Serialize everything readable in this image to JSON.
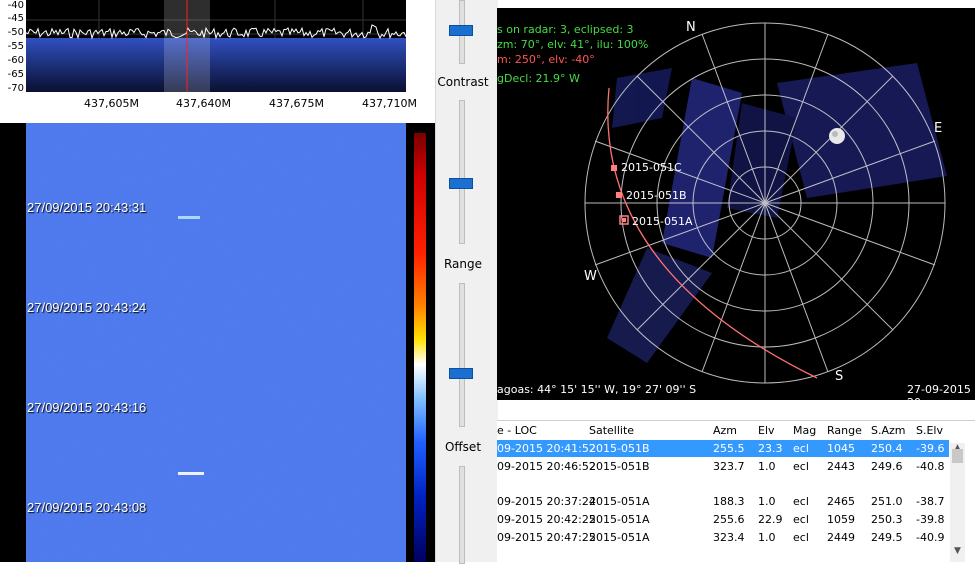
{
  "spectrum": {
    "y_labels": [
      "-40",
      "-45",
      "-50",
      "-55",
      "-60",
      "-65",
      "-70"
    ],
    "x_labels": [
      "437,605M",
      "437,640M",
      "437,675M",
      "437,710M"
    ]
  },
  "waterfall": {
    "timestamps": [
      "27/09/2015 20:43:31",
      "27/09/2015 20:43:24",
      "27/09/2015 20:43:16",
      "27/09/2015 20:43:08"
    ]
  },
  "controls": {
    "contrast_label": "Contrast",
    "range_label": "Range",
    "offset_label": "Offset"
  },
  "radar": {
    "info_line1": "s on radar: 3, eclipsed: 3",
    "info_line2": "zm: 70°, elv: 41°, ilu: 100%",
    "info_line3": "m: 250°, elv: -40°",
    "info_line4": "gDecl: 21.9° W",
    "compass_n": "N",
    "compass_e": "E",
    "compass_s": "S",
    "compass_w": "W",
    "sat1": "2015-051C",
    "sat2": "2015-051B",
    "sat3": "2015-051A",
    "location": "agoas: 44° 15' 15'' W, 19° 27' 09'' S",
    "datetime": "27-09-2015 20",
    "color_info1": "#44dd44",
    "color_info3": "#ff5555"
  },
  "table": {
    "headers": [
      "e - LOC",
      "Satellite",
      "Azm",
      "Elv",
      "Mag",
      "Range",
      "S.Azm",
      "S.Elv"
    ],
    "rows": [
      [
        "09-2015 20:41:52",
        "2015-051B",
        "255.5",
        "23.3",
        "ecl",
        "1045",
        "250.4",
        "-39.6"
      ],
      [
        "09-2015 20:46:52",
        "2015-051B",
        "323.7",
        "1.0",
        "ecl",
        "2443",
        "249.6",
        "-40.8"
      ],
      [
        "09-2015 20:37:24",
        "2015-051A",
        "188.3",
        "1.0",
        "ecl",
        "2465",
        "251.0",
        "-38.7"
      ],
      [
        "09-2015 20:42:25",
        "2015-051A",
        "255.6",
        "22.9",
        "ecl",
        "1059",
        "250.3",
        "-39.8"
      ],
      [
        "09-2015 20:47:25",
        "2015-051A",
        "323.4",
        "1.0",
        "ecl",
        "2449",
        "249.5",
        "-40.9"
      ]
    ],
    "selected_color": "#3399ff"
  }
}
